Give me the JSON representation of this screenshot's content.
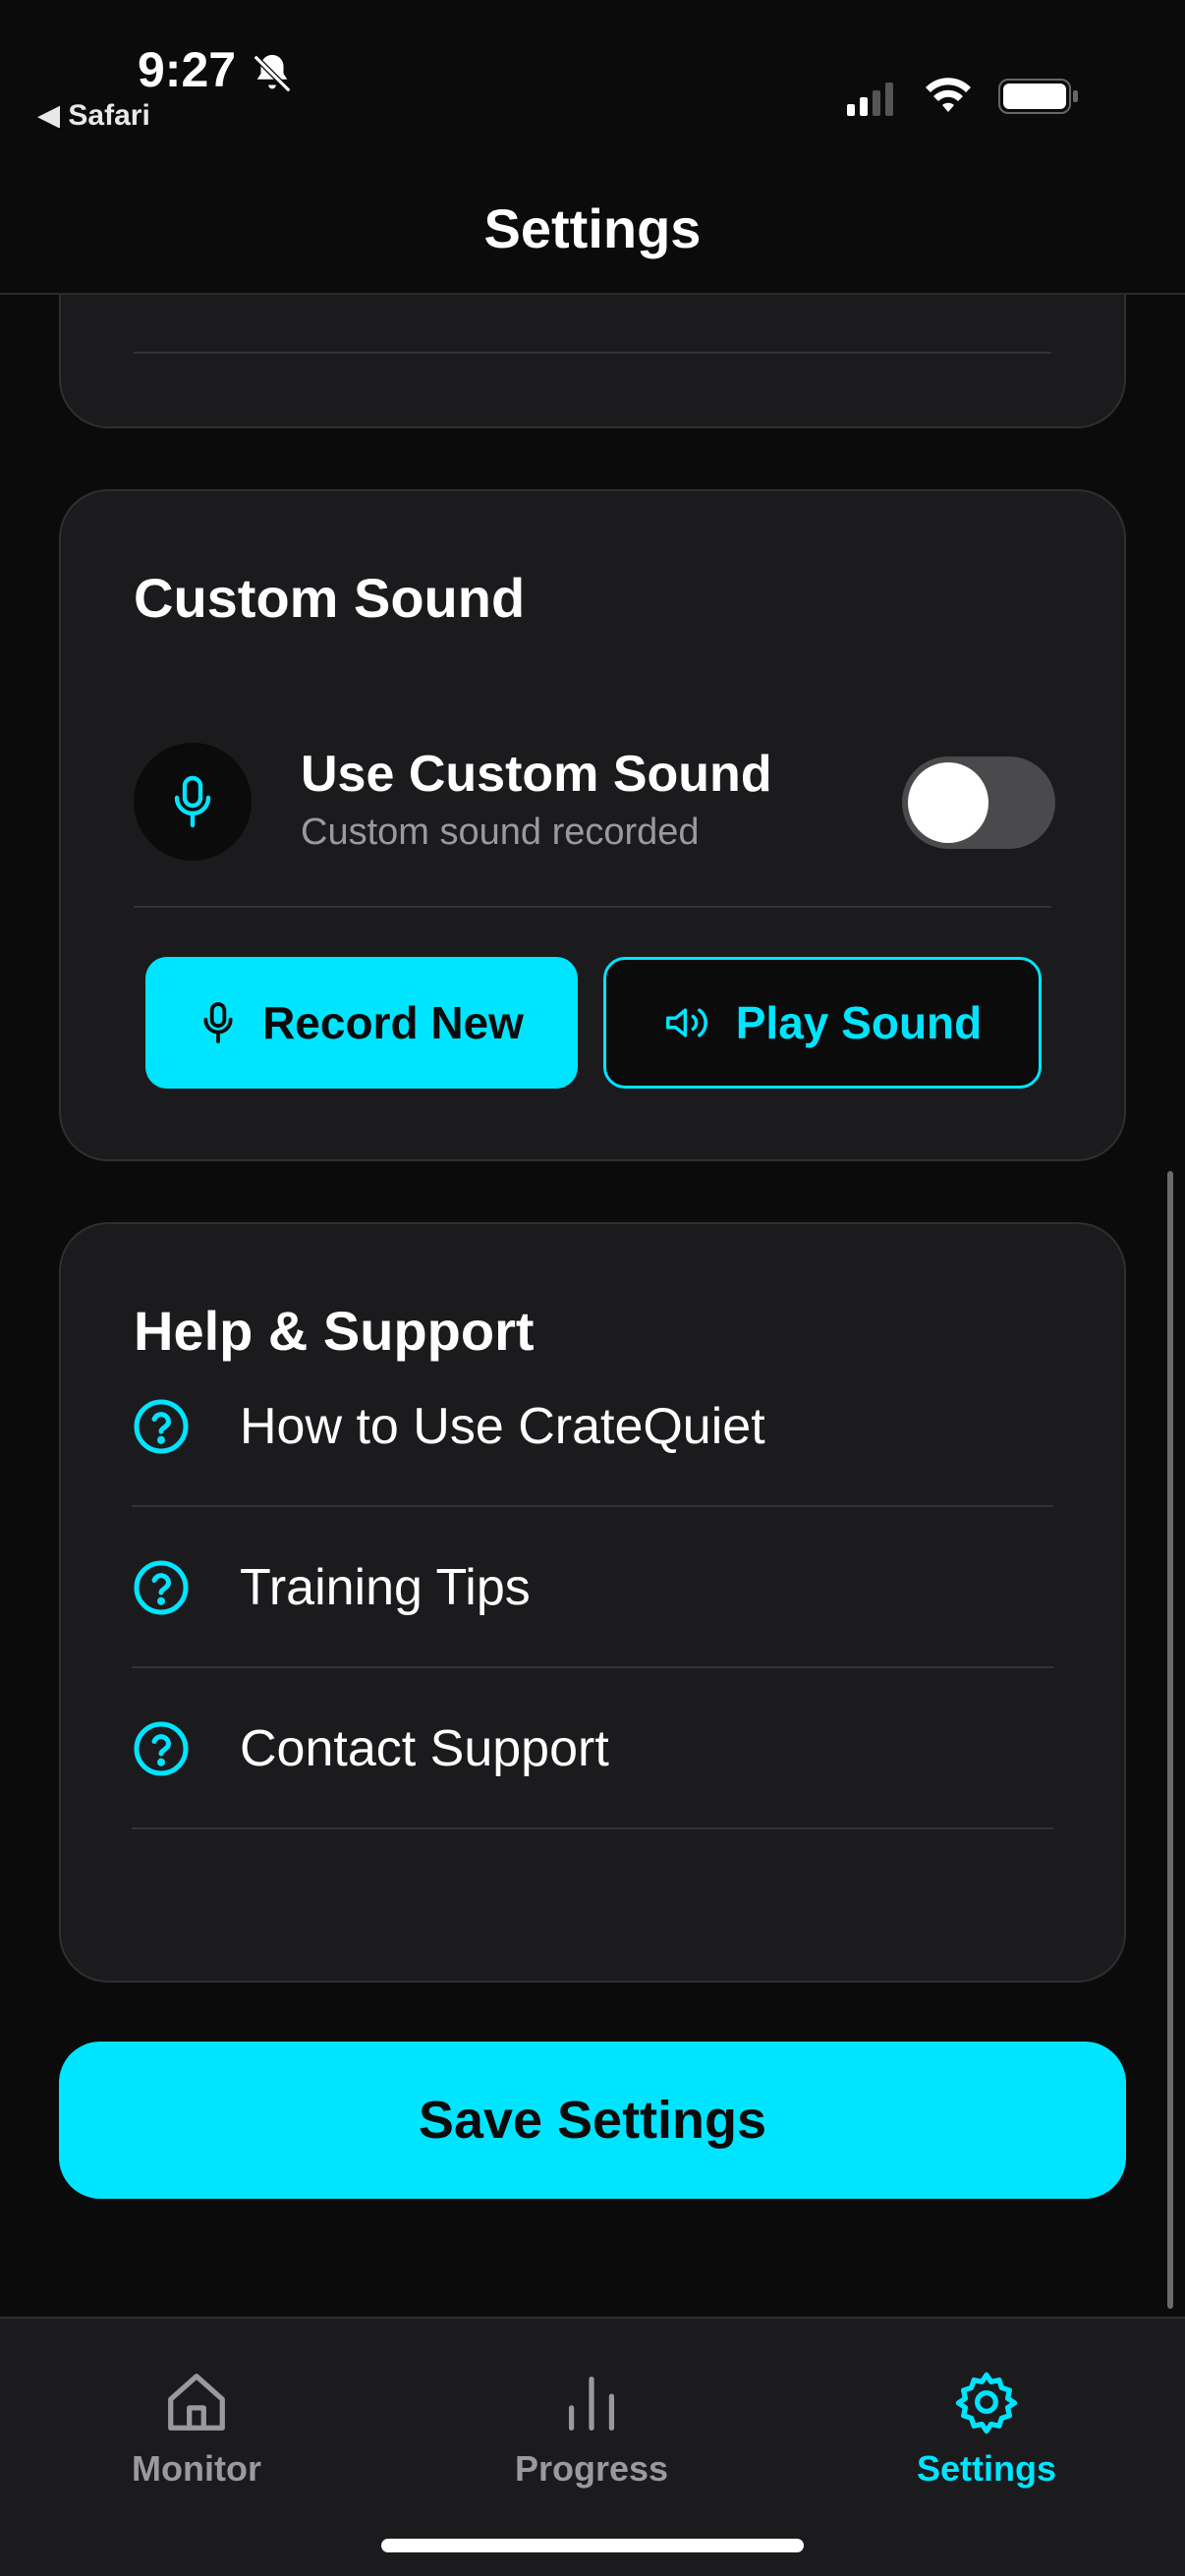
{
  "status_bar": {
    "time": "9:27",
    "back_app": "◀ Safari"
  },
  "header": {
    "title": "Settings"
  },
  "custom_sound": {
    "title": "Custom Sound",
    "toggle_title": "Use Custom Sound",
    "toggle_subtitle": "Custom sound recorded",
    "toggle_on": false,
    "record_label": "Record New",
    "play_label": "Play Sound"
  },
  "help": {
    "title": "Help & Support",
    "items": [
      {
        "label": "How to Use CrateQuiet",
        "icon": "question-circle-icon"
      },
      {
        "label": "Training Tips",
        "icon": "question-circle-icon"
      },
      {
        "label": "Contact Support",
        "icon": "question-circle-icon"
      }
    ]
  },
  "save_label": "Save Settings",
  "tabs": [
    {
      "label": "Monitor",
      "icon": "home-icon",
      "active": false
    },
    {
      "label": "Progress",
      "icon": "bar-chart-icon",
      "active": false
    },
    {
      "label": "Settings",
      "icon": "gear-icon",
      "active": true
    }
  ],
  "colors": {
    "accent": "#00e5ff",
    "background": "#0b0b0b",
    "card": "#1b1b1d",
    "muted_text": "#9a9a9e",
    "inactive_tab": "#9a9a9e"
  }
}
